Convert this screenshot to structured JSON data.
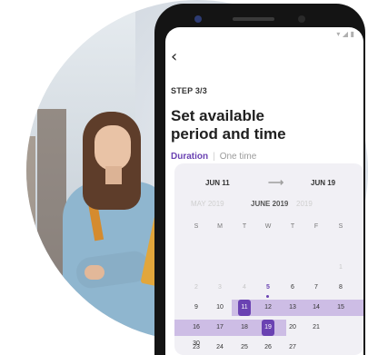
{
  "screen": {
    "back_icon": "chevron-left-icon",
    "step_label": "STEP 3/3",
    "title_line1": "Set available",
    "title_line2": "period and time",
    "tabs": {
      "active": "Duration",
      "separator": "|",
      "inactive": "One time"
    }
  },
  "calendar": {
    "range_start": "JUN 11",
    "range_arrow": "⟶",
    "range_end": "JUN 19",
    "prev_month": "MAY 2019",
    "current_month": "JUNE 2019",
    "next_month": "2019",
    "weekdays": [
      "S",
      "M",
      "T",
      "W",
      "T",
      "F",
      "S"
    ],
    "week1": [
      "",
      "",
      "",
      "",
      "",
      "",
      "1"
    ],
    "week2": [
      "2",
      "3",
      "4",
      "5",
      "6",
      "7",
      "8"
    ],
    "week3": [
      "9",
      "10",
      "11",
      "12",
      "13",
      "14",
      "15"
    ],
    "week4": [
      "16",
      "17",
      "18",
      "19",
      "20",
      "21",
      ""
    ],
    "week5": [
      "23",
      "24",
      "25",
      "26",
      "27",
      "",
      ""
    ],
    "week6": [
      "30",
      "",
      "",
      "",
      "",
      "",
      ""
    ]
  },
  "colors": {
    "accent": "#6a42b2",
    "range": "#cdbde5",
    "card": "#f1f0f5"
  }
}
